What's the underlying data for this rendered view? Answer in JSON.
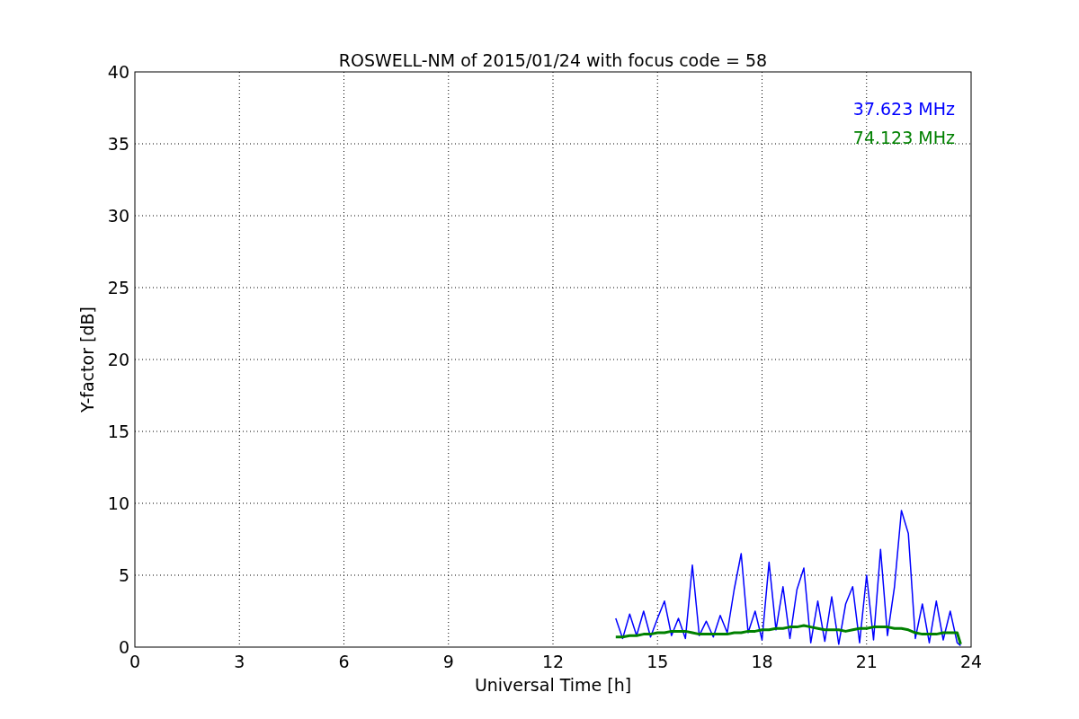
{
  "figure": {
    "chart_data": {
      "type": "line",
      "title": "ROSWELL-NM of 2015/01/24 with focus code = 58",
      "xlabel": "Universal Time [h]",
      "ylabel": "Y-factor [dB]",
      "grid": true,
      "xlim": [
        0,
        24
      ],
      "ylim": [
        0,
        40
      ],
      "xticks": [
        0,
        3,
        6,
        9,
        12,
        15,
        18,
        21,
        24
      ],
      "yticks": [
        0,
        5,
        10,
        15,
        20,
        25,
        30,
        35,
        40
      ],
      "x": [
        13.8,
        14,
        14.2,
        14.4,
        14.6,
        14.8,
        15,
        15.2,
        15.4,
        15.6,
        15.8,
        16,
        16.2,
        16.4,
        16.6,
        16.8,
        17,
        17.2,
        17.4,
        17.6,
        17.8,
        18,
        18.2,
        18.4,
        18.6,
        18.8,
        19,
        19.2,
        19.4,
        19.6,
        19.8,
        20,
        20.2,
        20.4,
        20.6,
        20.8,
        21,
        21.2,
        21.4,
        21.6,
        21.8,
        22,
        22.2,
        22.4,
        22.6,
        22.8,
        23,
        23.2,
        23.4,
        23.6,
        23.7
      ],
      "series": [
        {
          "name": "37.623 MHz",
          "color": "#0000ff",
          "values": [
            2.0,
            0.6,
            2.3,
            0.8,
            2.5,
            0.7,
            2.0,
            3.2,
            0.8,
            2.0,
            0.6,
            5.7,
            0.8,
            1.8,
            0.7,
            2.2,
            1.0,
            4.0,
            6.5,
            1.0,
            2.5,
            0.5,
            5.9,
            1.2,
            4.2,
            0.6,
            4.0,
            5.5,
            0.3,
            3.2,
            0.4,
            3.5,
            0.2,
            3.0,
            4.2,
            0.3,
            5.0,
            0.5,
            6.8,
            0.8,
            4.2,
            9.5,
            7.9,
            0.6,
            3.0,
            0.3,
            3.2,
            0.5,
            2.5,
            0.3,
            0.1
          ]
        },
        {
          "name": "74.123 MHz",
          "color": "#008000",
          "values": [
            0.7,
            0.7,
            0.8,
            0.8,
            0.9,
            0.9,
            1.0,
            1.0,
            1.1,
            1.1,
            1.1,
            1.0,
            0.9,
            0.9,
            0.9,
            0.9,
            0.9,
            1.0,
            1.0,
            1.1,
            1.1,
            1.2,
            1.2,
            1.3,
            1.3,
            1.4,
            1.4,
            1.5,
            1.4,
            1.3,
            1.2,
            1.2,
            1.2,
            1.1,
            1.2,
            1.3,
            1.3,
            1.4,
            1.4,
            1.4,
            1.3,
            1.3,
            1.2,
            1.0,
            0.9,
            0.9,
            0.9,
            1.0,
            1.0,
            1.0,
            0.2
          ]
        }
      ]
    }
  }
}
